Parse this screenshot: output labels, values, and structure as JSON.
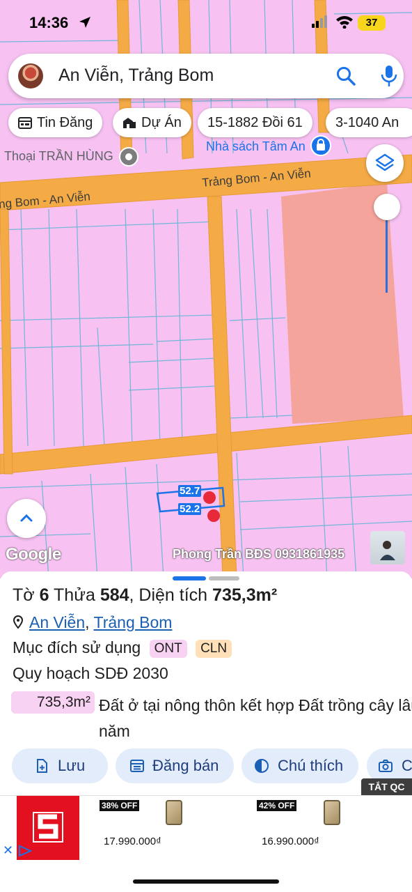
{
  "status_bar": {
    "time": "14:36",
    "battery": "37"
  },
  "search": {
    "query": "An Viễn, Trảng Bom"
  },
  "chips": [
    {
      "icon": "calendar-icon",
      "label": "Tin Đăng"
    },
    {
      "icon": "building-icon",
      "label": "Dự Án"
    },
    {
      "icon": "",
      "label": "15-1882 Đồi 61"
    },
    {
      "icon": "",
      "label": "3-1040 An"
    }
  ],
  "map": {
    "poi_left": "Thoại TRẦN HÙNG",
    "poi_right": "Nhà sách Tâm An",
    "road_label_right": "Trảng Bom - An Viễn",
    "road_label_left": "ng Bom - An Viễn",
    "dim_top": "52.7",
    "dim_bottom": "52.2",
    "google_logo": "Google",
    "watermark": "Phong Trần BĐS 0931861935",
    "colors": {
      "land": "#f7c2f2",
      "road": "#f5ab45",
      "parcel_line": "#6fb6d8",
      "highlight_zone": "#f4a49b",
      "marker": "#e8293a"
    }
  },
  "parcel": {
    "title_prefix": "Tờ",
    "to_number": "6",
    "thua_label": "Thửa",
    "thua_number": "584",
    "area_label": ", Diện tích",
    "area_value": "735,3m²",
    "location_commune": "An Viễn",
    "location_sep": ", ",
    "location_district": "Trảng Bom",
    "purpose_label": "Mục đích sử dụng",
    "purpose_tags": [
      "ONT",
      "CLN"
    ],
    "plan_label": "Quy hoạch SDĐ 2030",
    "plan_area": "735,3m²",
    "plan_desc": "Đất ở tại nông thôn kết hợp Đất trồng cây lâu năm"
  },
  "actions": [
    {
      "icon": "save-icon",
      "label": "Lưu"
    },
    {
      "icon": "listing-icon",
      "label": "Đăng bán"
    },
    {
      "icon": "legend-icon",
      "label": "Chú thích"
    },
    {
      "icon": "camera-icon",
      "label": "C"
    }
  ],
  "ad": {
    "tag": "TẮT QC",
    "items": [
      {
        "offer": "38% OFF",
        "price": "17.990.000₫"
      },
      {
        "offer": "42% OFF",
        "price": "16.990.000₫"
      }
    ]
  }
}
